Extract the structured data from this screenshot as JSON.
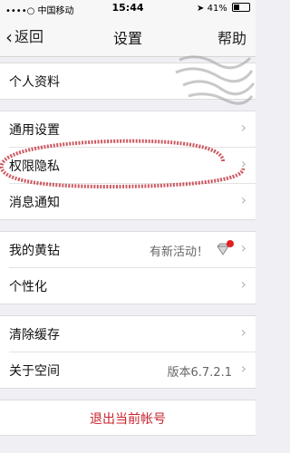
{
  "status_bar": {
    "carrier": "••••○ 中国移动",
    "time": "15:44",
    "battery": "41%"
  },
  "navbar": {
    "back_label": "返回",
    "title": "设置",
    "help_label": "帮助"
  },
  "groups": [
    {
      "items": [
        {
          "label": "个人资料"
        }
      ]
    },
    {
      "items": [
        {
          "label": "通用设置"
        },
        {
          "label": "权限隐私"
        },
        {
          "label": "消息通知"
        }
      ]
    },
    {
      "items": [
        {
          "label": "我的黄钻",
          "value": "有新活动！"
        },
        {
          "label": "个性化"
        }
      ]
    },
    {
      "items": [
        {
          "label": "清除缓存"
        },
        {
          "label": "关于空间",
          "value": "版本6.7.2.1"
        }
      ]
    }
  ],
  "logout_label": "退出当前帐号",
  "colors": {
    "logout_text": "#c8232c",
    "annotation": "#c0303a",
    "badge": "#e02020"
  },
  "icons": {
    "back": "chevron-left-icon",
    "row_arrow": "chevron-right-icon",
    "diamond": "yellow-diamond-icon"
  }
}
